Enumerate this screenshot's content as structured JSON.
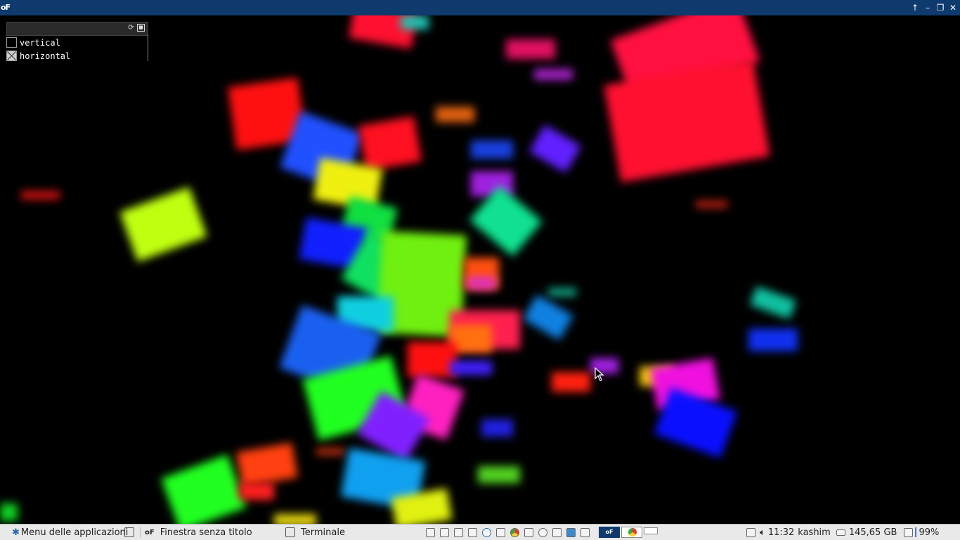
{
  "window": {
    "app_logo": "oF",
    "controls": [
      "up-arrow-icon",
      "minimize-icon",
      "maximize-icon",
      "close-icon"
    ]
  },
  "gui": {
    "header_icons": [
      "refresh-icon",
      "save-icon"
    ],
    "toggles": [
      {
        "label": "vertical",
        "checked": false
      },
      {
        "label": "horizontal",
        "checked": true
      }
    ]
  },
  "taskbar": {
    "menu_label": "Menu delle applicazioni",
    "task_1": "Finestra senza titolo",
    "task_2": "Terminale",
    "time": "11:32",
    "user": "kashim",
    "disk": "145,65 GB",
    "battery": "99%"
  },
  "colors": {
    "titlebar": "#0e3a6d",
    "taskbar": "#e9e9e9",
    "canvas_bg": "#000000"
  }
}
